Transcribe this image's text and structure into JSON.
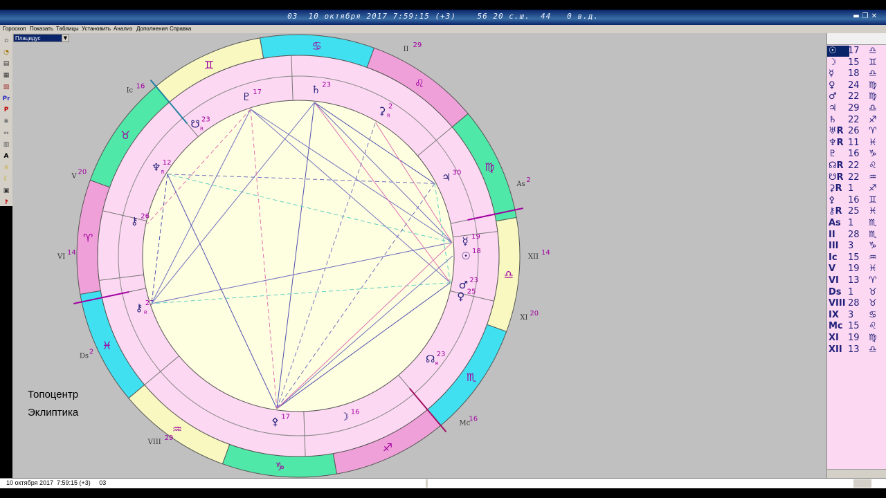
{
  "window": {
    "title": "03  10 октября 2017 7:59:15 (+3)    56 20 с.ш.  44   0 в.д."
  },
  "menu": [
    "Гороскоп",
    "Показать",
    "Таблицы",
    "Установить",
    "Анализ",
    "Дополнения",
    "Справка"
  ],
  "house_system": "Плацидус",
  "mode_labels": {
    "topocentric": "Топоцентр",
    "ecliptic": "Эклиптика"
  },
  "chart": {
    "zodiac_ring": [
      {
        "glyph": "♎",
        "color": "#f8f8c0"
      },
      {
        "glyph": "♍",
        "color": "#50e8a8"
      },
      {
        "glyph": "♌",
        "color": "#f0a0d8"
      },
      {
        "glyph": "♋",
        "color": "#40e0f0"
      },
      {
        "glyph": "♊",
        "color": "#f8f8c0"
      },
      {
        "glyph": "♉",
        "color": "#50e8a8"
      },
      {
        "glyph": "♈",
        "color": "#f0a0d8"
      },
      {
        "glyph": "♓",
        "color": "#40e0f0"
      },
      {
        "glyph": "♒",
        "color": "#f8f8c0"
      },
      {
        "glyph": "♑",
        "color": "#50e8a8"
      },
      {
        "glyph": "♐",
        "color": "#f0a0d8"
      },
      {
        "glyph": "♏",
        "color": "#40e0f0"
      }
    ],
    "house_cusps": [
      {
        "label": "As",
        "deg": "2"
      },
      {
        "label": "II",
        "deg": "29"
      },
      {
        "label": "III",
        "deg": "4"
      },
      {
        "label": "Ic",
        "deg": "16"
      },
      {
        "label": "V",
        "deg": "20"
      },
      {
        "label": "VI",
        "deg": "14"
      },
      {
        "label": "Ds",
        "deg": "2"
      },
      {
        "label": "VIII",
        "deg": "29"
      },
      {
        "label": "IX",
        "deg": "4"
      },
      {
        "label": "Mc",
        "deg": "16"
      },
      {
        "label": "XI",
        "deg": "20"
      },
      {
        "label": "XII",
        "deg": "14"
      }
    ],
    "planets": [
      {
        "glyph": "♇",
        "deg": "17",
        "retro": false
      },
      {
        "glyph": "♄",
        "deg": "23",
        "retro": false
      },
      {
        "glyph": "⚳",
        "deg": "2",
        "retro": true
      },
      {
        "glyph": "♃",
        "deg": "30",
        "retro": false
      },
      {
        "glyph": "☿",
        "deg": "19",
        "retro": false
      },
      {
        "glyph": "☉",
        "deg": "18",
        "retro": false
      },
      {
        "glyph": "♂",
        "deg": "23",
        "retro": false
      },
      {
        "glyph": "♀",
        "deg": "25",
        "retro": false
      },
      {
        "glyph": "☊",
        "deg": "23",
        "retro": true
      },
      {
        "glyph": "⚴",
        "deg": "17",
        "retro": false
      },
      {
        "glyph": "☽",
        "deg": "16",
        "retro": false
      },
      {
        "glyph": "⚷",
        "deg": "27",
        "retro": true
      },
      {
        "glyph": "⚷",
        "deg": "26",
        "retro": false
      },
      {
        "glyph": "♆",
        "deg": "12",
        "retro": true
      },
      {
        "glyph": "☋",
        "deg": "23",
        "retro": true
      }
    ],
    "retro_mark": "R"
  },
  "positions": [
    {
      "glyph": "☉",
      "deg": "17",
      "sign": "♎",
      "selected": true
    },
    {
      "glyph": "☽",
      "deg": "15",
      "sign": "♊"
    },
    {
      "glyph": "☿",
      "deg": "18",
      "sign": "♎"
    },
    {
      "glyph": "♀",
      "deg": "24",
      "sign": "♍"
    },
    {
      "glyph": "♂",
      "deg": "22",
      "sign": "♍"
    },
    {
      "glyph": "♃",
      "deg": "29",
      "sign": "♎"
    },
    {
      "glyph": "♄",
      "deg": "22",
      "sign": "♐"
    },
    {
      "glyph": "♅R",
      "deg": "26",
      "sign": "♈"
    },
    {
      "glyph": "♆R",
      "deg": "11",
      "sign": "♓"
    },
    {
      "glyph": "♇",
      "deg": "16",
      "sign": "♑"
    },
    {
      "glyph": "☊R",
      "deg": "22",
      "sign": "♌"
    },
    {
      "glyph": "☋R",
      "deg": "22",
      "sign": "♒"
    },
    {
      "glyph": "⚳R",
      "deg": "1",
      "sign": "♐"
    },
    {
      "glyph": "⚴",
      "deg": "16",
      "sign": "♊"
    },
    {
      "glyph": "⚷R",
      "deg": "25",
      "sign": "♓"
    },
    {
      "glyph": "As",
      "deg": "1",
      "sign": "♏"
    },
    {
      "glyph": "II",
      "deg": "28",
      "sign": "♏"
    },
    {
      "glyph": "III",
      "deg": "3",
      "sign": "♑"
    },
    {
      "glyph": "Ic",
      "deg": "15",
      "sign": "♒"
    },
    {
      "glyph": "V",
      "deg": "19",
      "sign": "♓"
    },
    {
      "glyph": "VI",
      "deg": "13",
      "sign": "♈"
    },
    {
      "glyph": "Ds",
      "deg": "1",
      "sign": "♉"
    },
    {
      "glyph": "VIII",
      "deg": "28",
      "sign": "♉"
    },
    {
      "glyph": "IX",
      "deg": "3",
      "sign": "♋"
    },
    {
      "glyph": "Mc",
      "deg": "15",
      "sign": "♌"
    },
    {
      "glyph": "XI",
      "deg": "19",
      "sign": "♍"
    },
    {
      "glyph": "XII",
      "deg": "13",
      "sign": "♎"
    }
  ],
  "status": {
    "text": "10 октября 2017  7:59:15 (+3)     03"
  },
  "toolbar_icons": [
    "new-chart-icon",
    "open-icon",
    "save-icon",
    "print-icon",
    "copy-icon",
    "pr-icon",
    "p-icon",
    "aspects-icon",
    "transits-icon",
    "grid-icon",
    "text-icon",
    "sun-icon",
    "moon-icon",
    "settings-icon",
    "help-icon"
  ],
  "toolbar_glyphs": [
    "▫",
    "◔",
    "▤",
    "▦",
    "▧",
    "Pr",
    "P",
    "✱",
    "↔",
    "▥",
    "A",
    "☼",
    "☾",
    "▣",
    "?"
  ]
}
